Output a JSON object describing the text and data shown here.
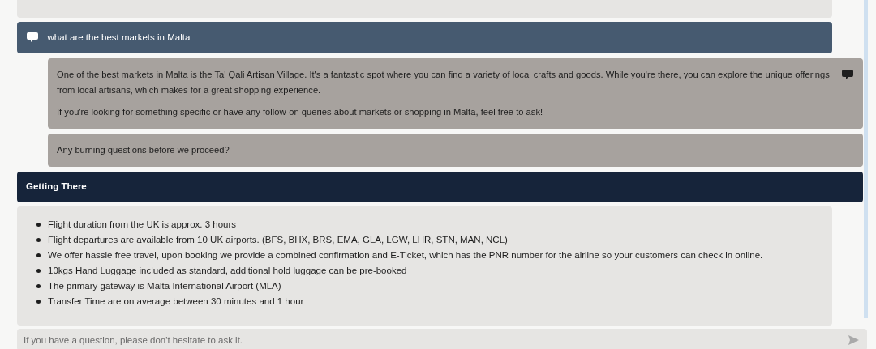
{
  "question": {
    "text": "what are the best markets in Malta"
  },
  "answers": [
    {
      "paragraphs": [
        "One of the best markets in Malta is the Ta' Qali Artisan Village. It's a fantastic spot where you can find a variety of local crafts and goods. While you're there, you can explore the unique offerings from local artisans, which makes for a great shopping experience.",
        "If you're looking for something specific or have any follow-on queries about markets or shopping in Malta, feel free to ask!"
      ],
      "icon": true
    },
    {
      "paragraphs": [
        "Any burning questions before we proceed?"
      ],
      "icon": false
    }
  ],
  "section": {
    "title": "Getting There",
    "items": [
      "Flight duration from the UK is approx. 3 hours",
      "Flight departures are available from 10 UK airports. (BFS, BHX, BRS, EMA, GLA, LGW, LHR, STN, MAN, NCL)",
      "We offer hassle free travel, upon booking we provide a combined confirmation and E-Ticket, which has the PNR number for the airline so your customers can check in online.",
      "10kgs Hand Luggage included as standard, additional hold luggage can be pre-booked",
      "The primary gateway is Malta International Airport (MLA)",
      "Transfer Time are on average between 30 minutes and 1 hour"
    ]
  },
  "input": {
    "placeholder": "If you have a question, please don't hesitate to ask it."
  }
}
